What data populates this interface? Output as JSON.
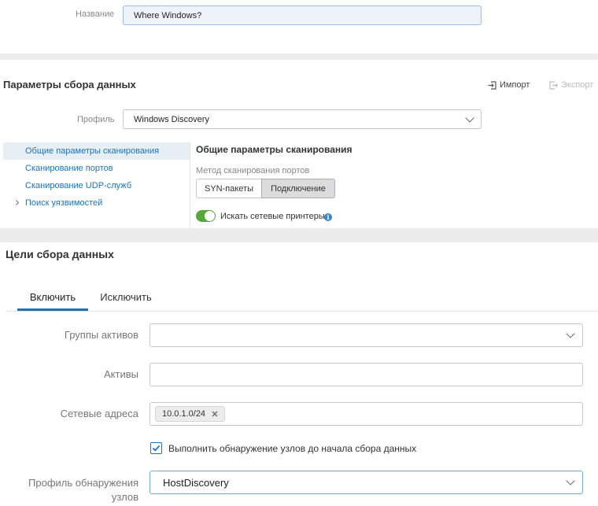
{
  "top": {
    "name_label": "Название",
    "name_value": "Where Windows?"
  },
  "collect": {
    "title": "Параметры сбора данных",
    "import_label": "Импорт",
    "export_label": "Экспорт",
    "profile_label": "Профиль",
    "profile_value": "Windows Discovery"
  },
  "side_nav": {
    "items": [
      {
        "label": "Общие параметры сканирования"
      },
      {
        "label": "Сканирование портов"
      },
      {
        "label": "Сканирование UDP-служб"
      },
      {
        "label": "Поиск уязвимостей"
      }
    ]
  },
  "general": {
    "title": "Общие параметры сканирования",
    "method_label": "Метод сканирования портов",
    "method_options": [
      "SYN-пакеты",
      "Подключение"
    ],
    "method_selected": "Подключение",
    "printers_label": "Искать сетевые принтеры",
    "printers_on": true
  },
  "targets": {
    "title": "Цели сбора данных",
    "tabs": [
      "Включить",
      "Исключить"
    ],
    "active_tab": "Включить",
    "asset_groups_label": "Группы активов",
    "assets_label": "Активы",
    "addresses_label": "Сетевые адреса",
    "address_tag": "10.0.1.0/24",
    "discovery_check_label": "Выполнить обнаружение узлов до начала сбора данных",
    "discovery_checked": true,
    "discovery_profile_label_1": "Профиль обнаружения",
    "discovery_profile_label_2": "узлов",
    "discovery_profile_value": "HostDiscovery"
  },
  "colors": {
    "accent": "#1f72b8",
    "nav_active_bg": "#e6eef6",
    "toggle_on": "#57a83a",
    "checkbox": "#1f72b8"
  }
}
